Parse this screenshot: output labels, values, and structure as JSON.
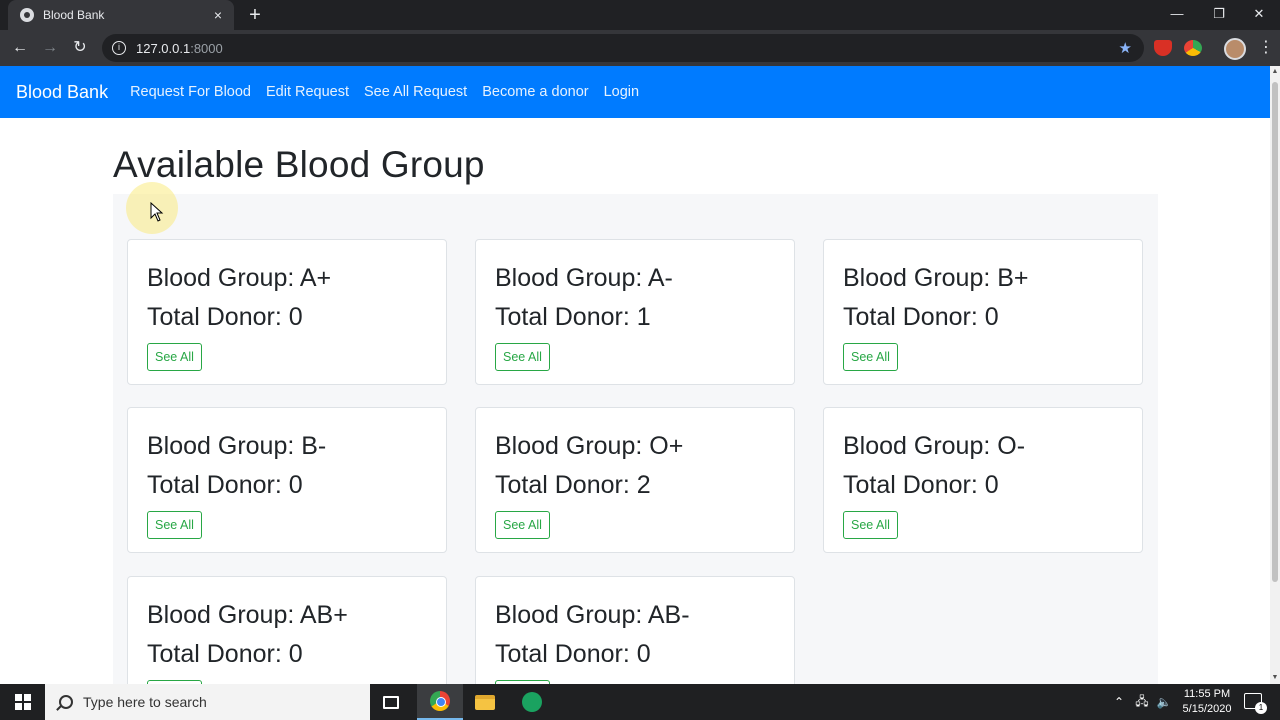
{
  "browser": {
    "tab_title": "Blood Bank",
    "tab_close": "×",
    "new_tab": "+",
    "url_host": "127.0.0.1",
    "url_port": ":8000",
    "window_minimize": "—",
    "window_restore": "❐",
    "window_close": "✕"
  },
  "navbar": {
    "brand": "Blood Bank",
    "links": [
      "Request For Blood",
      "Edit Request",
      "See All Request",
      "Become a donor",
      "Login"
    ]
  },
  "page": {
    "heading": "Available Blood Group",
    "see_all_label": "See All"
  },
  "cards": [
    {
      "group": "Blood Group: A+",
      "donors": "Total Donor: 0"
    },
    {
      "group": "Blood Group: A-",
      "donors": "Total Donor: 1"
    },
    {
      "group": "Blood Group: B+",
      "donors": "Total Donor: 0"
    },
    {
      "group": "Blood Group: B-",
      "donors": "Total Donor: 0"
    },
    {
      "group": "Blood Group: O+",
      "donors": "Total Donor: 2"
    },
    {
      "group": "Blood Group: O-",
      "donors": "Total Donor: 0"
    },
    {
      "group": "Blood Group: AB+",
      "donors": "Total Donor: 0"
    },
    {
      "group": "Blood Group: AB-",
      "donors": "Total Donor: 0"
    }
  ],
  "taskbar": {
    "search_placeholder": "Type here to search",
    "time": "11:55 PM",
    "date": "5/15/2020",
    "notification_count": "1"
  },
  "colors": {
    "navbar": "#007bff",
    "see_all_button": "#28a745"
  }
}
